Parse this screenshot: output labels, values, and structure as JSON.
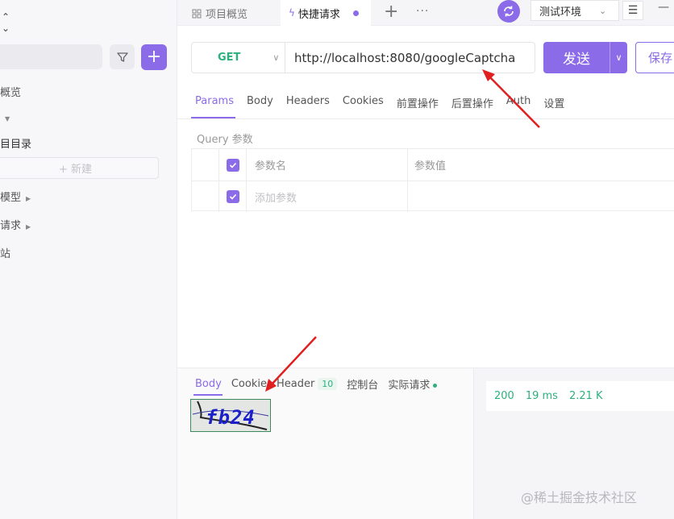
{
  "sidebar": {
    "items": [
      {
        "label": "概览",
        "has_arrow": false
      },
      {
        "label": "",
        "has_arrow": true
      },
      {
        "label": "目目录",
        "has_arrow": false
      },
      {
        "label": "模型",
        "has_arrow": true
      },
      {
        "label": "请求",
        "has_arrow": true
      },
      {
        "label": "站",
        "has_arrow": false
      }
    ],
    "new_button": "+ 新建"
  },
  "tabs": {
    "overview": "项目概览",
    "active": "快捷请求"
  },
  "environment": "测试环境",
  "request": {
    "method": "GET",
    "url": "http://localhost:8080/googleCaptcha",
    "send_label": "发送",
    "save_label": "保存"
  },
  "request_tabs": [
    "Params",
    "Body",
    "Headers",
    "Cookies",
    "前置操作",
    "后置操作",
    "Auth",
    "设置"
  ],
  "query": {
    "title": "Query 参数",
    "header_name": "参数名",
    "header_value": "参数值",
    "add_placeholder": "添加参数"
  },
  "response_tabs": {
    "body": "Body",
    "cookie": "Cookie",
    "header": "Header",
    "header_count": "10",
    "console": "控制台",
    "actual": "实际请求"
  },
  "response_status": {
    "code": "200",
    "time": "19 ms",
    "size": "2.21 K"
  },
  "captcha_text": "fb24",
  "watermark": "@稀土掘金技术社区",
  "colors": {
    "accent": "#8b6be8",
    "success": "#2db07d",
    "annotation_arrow": "#e02020"
  }
}
